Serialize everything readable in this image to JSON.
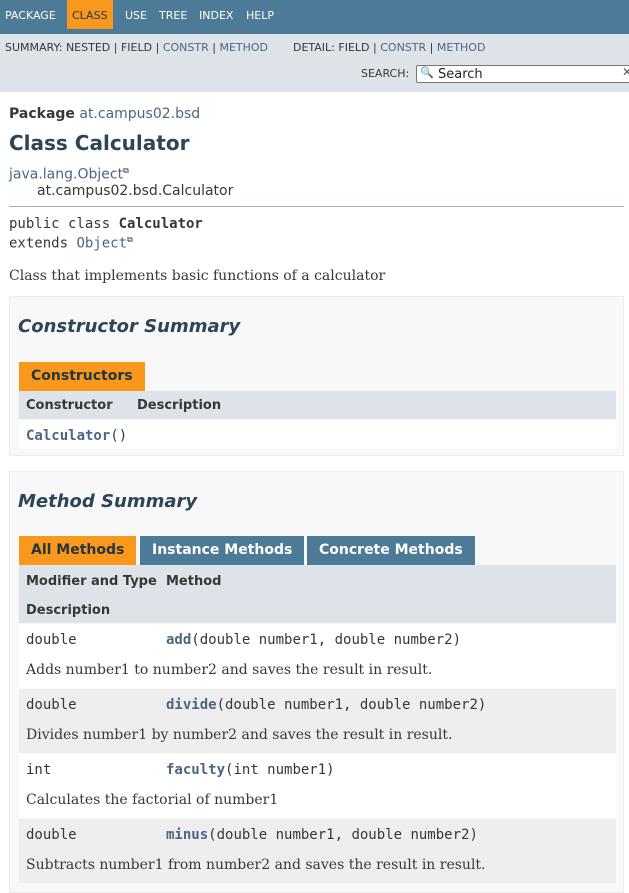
{
  "topnav": {
    "items": [
      "PACKAGE",
      "CLASS",
      "USE",
      "TREE",
      "INDEX",
      "HELP"
    ],
    "active": "CLASS"
  },
  "subnav": {
    "summary_label": "SUMMARY:",
    "nested": "NESTED",
    "field": "FIELD",
    "constr": "CONSTR",
    "method": "METHOD",
    "detail_label": "DETAIL:",
    "d_field": "FIELD",
    "d_constr": "CONSTR",
    "d_method": "METHOD",
    "sep": "|",
    "search_label": "SEARCH:",
    "search_placeholder": "Search"
  },
  "header": {
    "package_label": "Package",
    "package_name": "at.campus02.bsd",
    "class_title": "Class Calculator",
    "inheritance_root": "java.lang.Object",
    "inheritance_child": "at.campus02.bsd.Calculator"
  },
  "signature": {
    "line1_prefix": "public class ",
    "class_name": "Calculator",
    "line2_prefix": "extends ",
    "superclass": "Object"
  },
  "class_description": "Class that implements basic functions of a calculator",
  "constructor_summary": {
    "title": "Constructor Summary",
    "tab": "Constructors",
    "col_constructor": "Constructor",
    "col_description": "Description",
    "rows": [
      {
        "name": "Calculator",
        "params": "()"
      }
    ]
  },
  "method_summary": {
    "title": "Method Summary",
    "tabs": [
      "All Methods",
      "Instance Methods",
      "Concrete Methods"
    ],
    "col_modifier": "Modifier and Type",
    "col_method": "Method",
    "col_description": "Description",
    "rows": [
      {
        "type": "double",
        "name": "add",
        "params": "(double number1, double number2)",
        "description": "Adds number1 to number2 and saves the result in result."
      },
      {
        "type": "double",
        "name": "divide",
        "params": "(double number1, double number2)",
        "description": "Divides number1 by number2 and saves the result in result."
      },
      {
        "type": "int",
        "name": "faculty",
        "params": "(int number1)",
        "description": "Calculates the factorial of number1"
      },
      {
        "type": "double",
        "name": "minus",
        "params": "(double number1, double number2)",
        "description": "Subtracts number1 from number2 and saves the result in result."
      }
    ]
  },
  "colors": {
    "nav": "#4D7A97",
    "active": "#F8981D",
    "subnav": "#dee3e9",
    "link": "#4A6782"
  }
}
